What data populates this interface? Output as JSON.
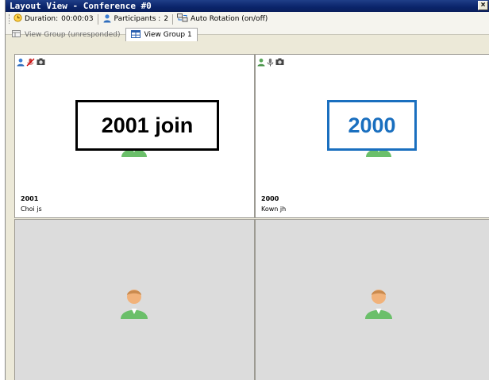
{
  "window": {
    "title": "Layout View - Conference #0",
    "close_glyph": "×"
  },
  "toolbar": {
    "duration_label": "Duration:",
    "duration_value": "00:00:03",
    "participants_label": "Participants :",
    "participants_value": "2",
    "auto_rotation_label": "Auto Rotation (on/off)"
  },
  "tabs": [
    {
      "label": "View Group (unresponded)",
      "active": false
    },
    {
      "label": "View Group 1",
      "active": true
    }
  ],
  "panes": [
    {
      "id": "2001",
      "name": "Choi js",
      "callout": "2001 join",
      "callout_color": "#000000"
    },
    {
      "id": "2000",
      "name": "Kown jh",
      "callout": "2000",
      "callout_color": "#1a6fbf"
    }
  ],
  "colors": {
    "titlebar": "#0a246a",
    "empty_pane": "#dcdcdc",
    "accent_blue": "#1a6fbf"
  },
  "icons": [
    "clock-icon",
    "participant-icon",
    "rotation-icon",
    "view-group-icon",
    "user-status-icon",
    "mic-muted-icon",
    "mic-icon",
    "camera-icon",
    "avatar-icon",
    "close-icon"
  ]
}
